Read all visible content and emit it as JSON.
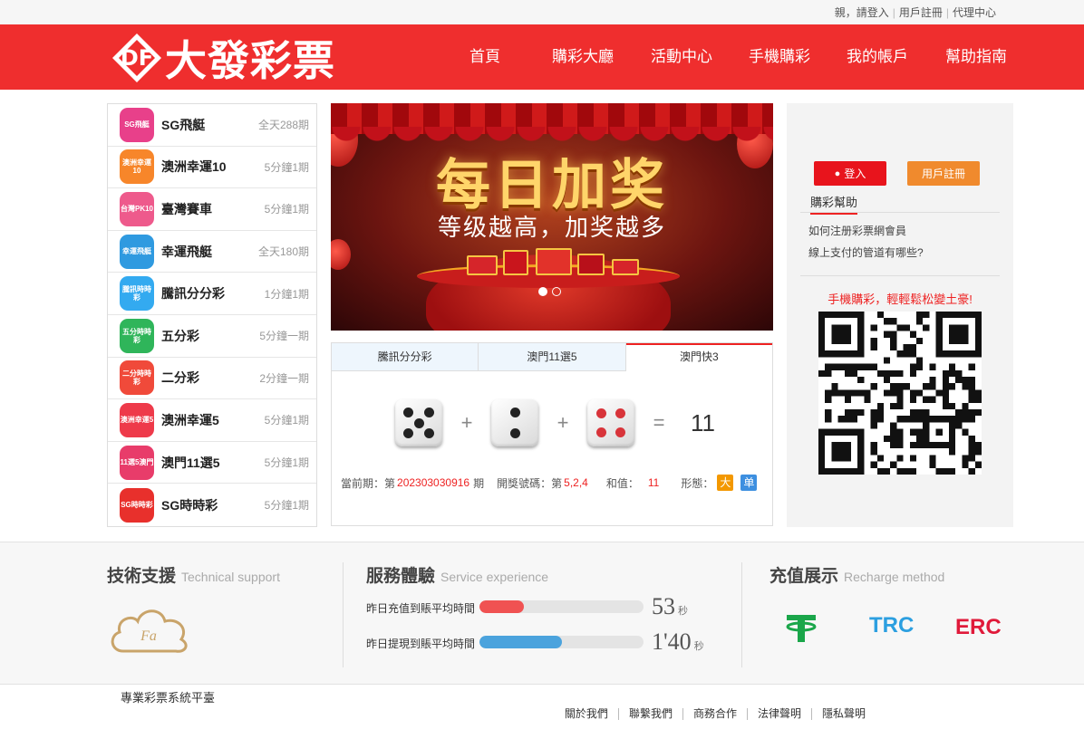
{
  "topbar": {
    "greeting": "親，請登入",
    "register": "用戶註冊",
    "agent": "代理中心"
  },
  "header": {
    "logo_mark": "DF",
    "logo_text": "大發彩票",
    "nav": [
      "首頁",
      "購彩大廳",
      "活動中心",
      "手機購彩",
      "我的帳戶",
      "幫助指南"
    ]
  },
  "lotteries": [
    {
      "name": "SG飛艇",
      "period": "全天288期",
      "icon": "SG飛艇",
      "color": "#e8408a"
    },
    {
      "name": "澳洲幸運10",
      "period": "5分鐘1期",
      "icon": "澳洲幸運10",
      "color": "#f7862a"
    },
    {
      "name": "臺灣賽車",
      "period": "5分鐘1期",
      "icon": "台灣PK10",
      "color": "#ee5a8c"
    },
    {
      "name": "幸運飛艇",
      "period": "全天180期",
      "icon": "幸運飛艇",
      "color": "#2f9ae0"
    },
    {
      "name": "騰訊分分彩",
      "period": "1分鐘1期",
      "icon": "騰訊時時彩",
      "color": "#33aaf0"
    },
    {
      "name": "五分彩",
      "period": "5分鐘一期",
      "icon": "五分時時彩",
      "color": "#2fb55a"
    },
    {
      "name": "二分彩",
      "period": "2分鐘一期",
      "icon": "二分時時彩",
      "color": "#f04a3a"
    },
    {
      "name": "澳洲幸運5",
      "period": "5分鐘1期",
      "icon": "澳洲幸運5",
      "color": "#ee3a4a"
    },
    {
      "name": "澳門11選5",
      "period": "5分鐘1期",
      "icon": "11選5澳門",
      "color": "#e83c6a"
    },
    {
      "name": "SG時時彩",
      "period": "5分鐘1期",
      "icon": "SG時時彩",
      "color": "#e8302c"
    }
  ],
  "banner": {
    "title": "每日加奖",
    "subtitle": "等级越高，加奖越多",
    "slides": 2,
    "active_slide": 1
  },
  "results": {
    "tabs": [
      "騰訊分分彩",
      "澳門11選5",
      "澳門快3"
    ],
    "active_tab": 2,
    "dice": [
      5,
      2,
      4
    ],
    "plus": "+",
    "equals": "=",
    "sum": "11",
    "period_label": "當前期：第",
    "period": "202303030916",
    "period_suffix": "期",
    "numbers_label": "開獎號碼：第",
    "numbers": "5,2,4",
    "sum_label": "和值：",
    "sum_value": "11",
    "shape_label": "形態：",
    "size_badge": "大",
    "parity_badge": "单",
    "badge_colors": {
      "size": "#f39800",
      "parity": "#3d8fe0"
    }
  },
  "account": {
    "login": "登入",
    "register": "用戶註冊",
    "help_title": "購彩幫助",
    "help_links": [
      "如何注册彩票網會員",
      "線上支付的管道有哪些?"
    ],
    "promo": "手機購彩，輕輕鬆松變土豪!"
  },
  "footer": {
    "support": {
      "title": "技術支援",
      "en": "Technical support",
      "logo": "Fa"
    },
    "service": {
      "title": "服務體驗",
      "en": "Service experience",
      "bars": [
        {
          "label": "昨日充值到賬平均時間",
          "value": "53",
          "unit": "秒",
          "fraction": 0.27,
          "color": "#f05252"
        },
        {
          "label": "昨日提現到賬平均時間",
          "value": "1'40",
          "unit": "秒",
          "fraction": 0.5,
          "color": "#4ba3dd"
        }
      ]
    },
    "recharge": {
      "title": "充值展示",
      "en": "Recharge method",
      "methods": [
        {
          "name": "tether",
          "color": "#1aa64a"
        },
        {
          "name": "TRC",
          "color": "#2c9fe0"
        },
        {
          "name": "ERC",
          "color": "#e01a3a"
        }
      ]
    }
  },
  "bottom": {
    "copyright": "專業彩票系統平臺",
    "links": [
      "關於我們",
      "聯繫我們",
      "商務合作",
      "法律聲明",
      "隱私聲明"
    ]
  }
}
